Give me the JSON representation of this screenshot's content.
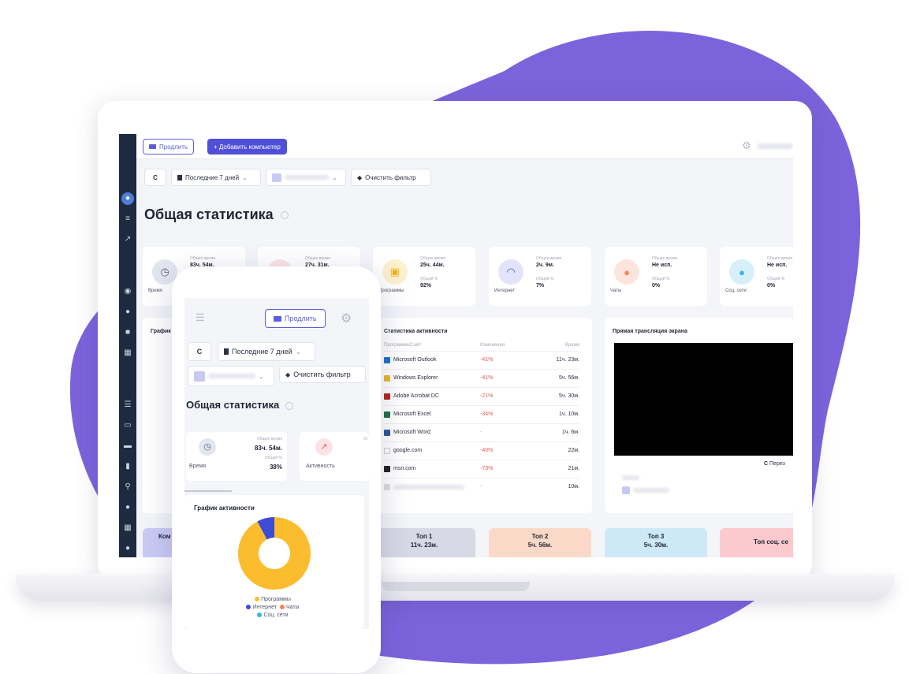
{
  "toolbar": {
    "extend_label": "Продлить",
    "add_computer_label": "+ Добавить компьютер"
  },
  "filters": {
    "period_label": "Последние 7 дней",
    "clear_label": "Очистить фильтр"
  },
  "page_title": "Общая статистика",
  "stats": [
    {
      "caption": "Время",
      "l1": "Общее время",
      "v1": "83ч. 54м.",
      "l2": "",
      "v2": ""
    },
    {
      "caption": "",
      "l1": "Общее время",
      "v1": "27ч. 31м.",
      "l2": "",
      "v2": ""
    },
    {
      "caption": "Программы",
      "l1": "Общее время",
      "v1": "25ч. 44м.",
      "l2": "Общий %",
      "v2": "92%"
    },
    {
      "caption": "Интернет",
      "l1": "Общее время",
      "v1": "2ч. 9м.",
      "l2": "Общий %",
      "v2": "7%"
    },
    {
      "caption": "Чаты",
      "l1": "Общее время",
      "v1": "Не исп.",
      "l2": "Общий %",
      "v2": "0%"
    },
    {
      "caption": "Соц. сети",
      "l1": "Общее время",
      "v1": "Не исп.",
      "l2": "Общий %",
      "v2": "0%"
    }
  ],
  "left_panel_title": "График",
  "activity": {
    "title": "Статистика активности",
    "headers": [
      "Программа/Сайт",
      "Изменения",
      "Время"
    ],
    "rows": [
      {
        "name": "Microsoft Outlook",
        "change": "-41%",
        "time": "11ч. 23м.",
        "color": "#1f6fd0"
      },
      {
        "name": "Windows Explorer",
        "change": "-41%",
        "time": "5ч. 56м.",
        "color": "#e8b431"
      },
      {
        "name": "Adobe Acrobat DC",
        "change": "-21%",
        "time": "5ч. 30м.",
        "color": "#b3261e"
      },
      {
        "name": "Microsoft Excel",
        "change": "-34%",
        "time": "1ч. 10м.",
        "color": "#1e7145"
      },
      {
        "name": "Microsoft Word",
        "change": "-",
        "time": "1ч. 6м.",
        "color": "#2b579a"
      },
      {
        "name": "google.com",
        "change": "-40%",
        "time": "22м.",
        "color": "#ffffff"
      },
      {
        "name": "msn.com",
        "change": "-73%",
        "time": "21м.",
        "color": "#222222"
      },
      {
        "name": "",
        "change": "-",
        "time": "10м.",
        "color": "#dddddd"
      }
    ]
  },
  "live": {
    "title": "Прямая трансляция экрана",
    "refresh_label": "Перез"
  },
  "tops": [
    {
      "title": "Топ 1",
      "value": "11ч. 23м.",
      "color": "#d8d9e6"
    },
    {
      "title": "Топ 2",
      "value": "5ч. 56м.",
      "color": "#fbd9c9"
    },
    {
      "title": "Топ 3",
      "value": "5ч. 30м.",
      "color": "#cde8f6"
    },
    {
      "title": "Топ соц. се",
      "value": "",
      "color": "#fbc9ce"
    }
  ],
  "bottom_left_label": "Ком",
  "phone": {
    "extend_label": "Продлить",
    "period_label": "Последние 7 дней",
    "clear_label": "Очистить фильтр",
    "title": "Общая статистика",
    "card1": {
      "l1": "Общее время",
      "v1": "83ч. 54м.",
      "l2": "Общий %",
      "v2": "38%",
      "caption": "Время"
    },
    "card2": {
      "caption": "Активность",
      "l1": "Оі"
    },
    "chart_title": "График активности",
    "legend": [
      {
        "label": "Программы",
        "color": "#fbbd2e"
      },
      {
        "label": "Интернет",
        "color": "#3d4bd6"
      },
      {
        "label": "Чаты",
        "color": "#f4845f"
      },
      {
        "label": "Соц. сети",
        "color": "#3ab4e6"
      }
    ]
  },
  "chart_data": {
    "type": "pie",
    "categories": [
      "Программы",
      "Интернет"
    ],
    "values": [
      92.3,
      7.8
    ],
    "data_labels": [
      "92.3%",
      "7.8%"
    ],
    "title": "График активности"
  },
  "colors": {
    "accent": "#4f4fd9",
    "blob": "#7b63dc",
    "sidebar": "#1e2a3f"
  }
}
